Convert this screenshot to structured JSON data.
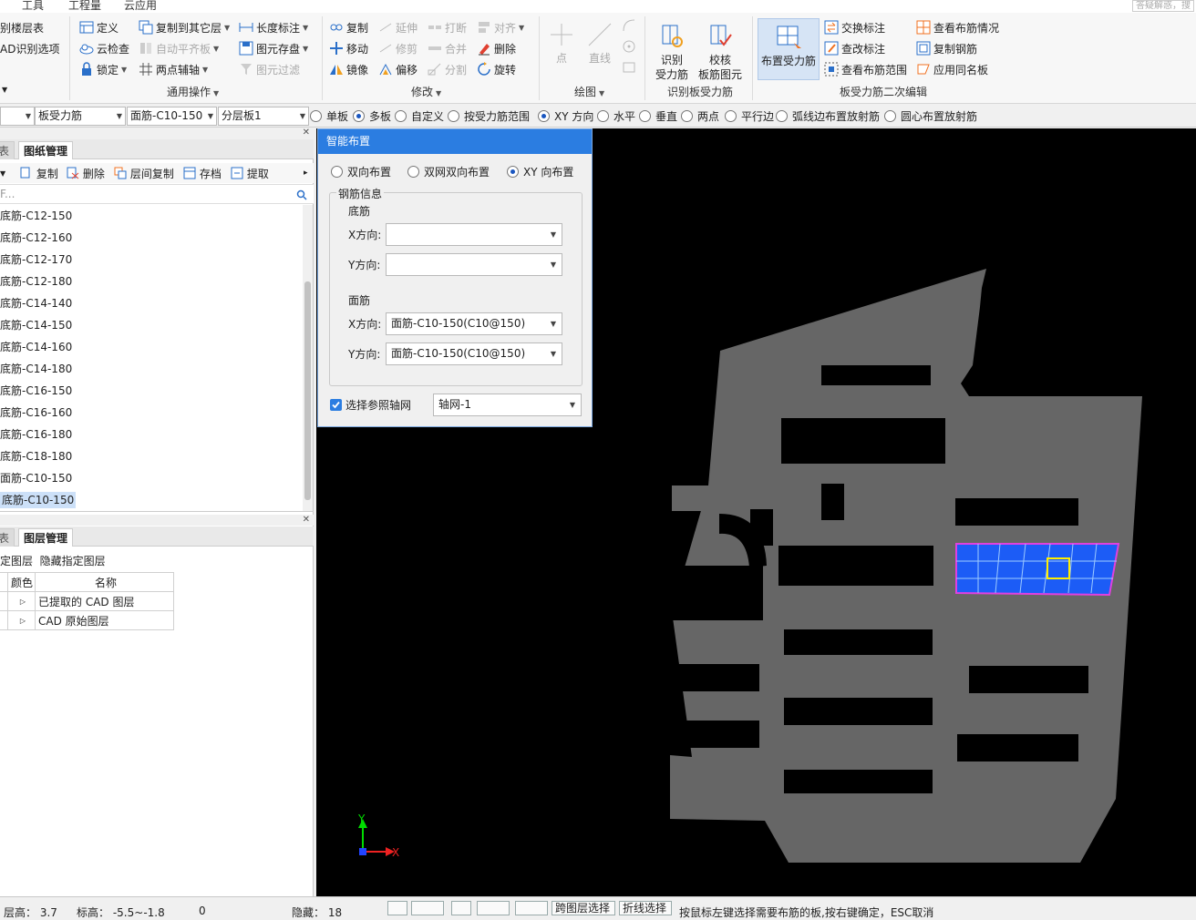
{
  "menu": {
    "items": [
      "工具",
      "工程量",
      "云应用"
    ],
    "search_hint": "答疑解惑，搜"
  },
  "ribbon": {
    "group1": {
      "items": [
        "别楼层表",
        "AD识别选项"
      ]
    },
    "group2": {
      "label": "通用操作",
      "items": [
        "定义",
        "云检查",
        "锁定",
        "复制到其它层",
        "自动平齐板",
        "两点辅轴",
        "长度标注",
        "图元存盘",
        "图元过滤"
      ]
    },
    "group3": {
      "label": "修改",
      "items": [
        "复制",
        "移动",
        "镜像",
        "延伸",
        "修剪",
        "偏移",
        "打断",
        "合并",
        "分割",
        "对齐",
        "删除",
        "旋转"
      ]
    },
    "group4": {
      "label": "绘图",
      "items": [
        "点",
        "直线"
      ]
    },
    "group5": {
      "label": "识别板受力筋",
      "items": [
        "识别\n受力筋",
        "校核\n板筋图元"
      ]
    },
    "group6": {
      "label": "板受力筋二次编辑",
      "big_item": "布置受力筋",
      "items": [
        "交换标注",
        "查改标注",
        "查看布筋范围",
        "查看布筋情况",
        "复制钢筋",
        "应用同名板"
      ]
    }
  },
  "toolbar2": {
    "combo0": "",
    "combo1": "板受力筋",
    "combo2": "面筋-C10-150",
    "combo3": "分层板1",
    "radios_left": [
      "单板",
      "多板",
      "自定义",
      "按受力筋范围"
    ],
    "radios_left_selected": "多板",
    "radios_right": [
      "XY 方向",
      "水平",
      "垂直",
      "两点",
      "平行边",
      "弧线边布置放射筋",
      "圆心布置放射筋"
    ],
    "radios_right_selected": "XY 方向"
  },
  "left_panel": {
    "tabs": [
      "表",
      "图纸管理"
    ],
    "toolbar": [
      "复制",
      "删除",
      "层间复制",
      "存档",
      "提取"
    ],
    "search_placeholder": "F...",
    "list_items": [
      "底筋-C12-150",
      "底筋-C12-160",
      "底筋-C12-170",
      "底筋-C12-180",
      "底筋-C14-140",
      "底筋-C14-150",
      "底筋-C14-160",
      "底筋-C14-180",
      "底筋-C16-150",
      "底筋-C16-160",
      "底筋-C16-180",
      "底筋-C18-180",
      "面筋-C10-150",
      "底筋-C10-150"
    ],
    "selected_index": 13,
    "bottom_tabs": [
      "表",
      "图层管理"
    ],
    "bottom_links": [
      "定图层",
      "隐藏指定图层"
    ],
    "table_headers": [
      "颜色",
      "名称"
    ],
    "table_rows": [
      "已提取的 CAD 图层",
      "CAD 原始图层"
    ]
  },
  "dialog": {
    "title": "智能布置",
    "modes": [
      "双向布置",
      "双网双向布置",
      "XY 向布置"
    ],
    "mode_selected": "XY 向布置",
    "group_title": "钢筋信息",
    "bottom_label": "底筋",
    "top_label": "面筋",
    "x_label": "X方向:",
    "y_label": "Y方向:",
    "bottom_x": "",
    "bottom_y": "",
    "top_x": "面筋-C10-150(C10@150)",
    "top_y": "面筋-C10-150(C10@150)",
    "ref_axis_checkbox": "选择参照轴网",
    "ref_axis_checked": true,
    "ref_axis_value": "轴网-1"
  },
  "canvas": {
    "axis_x": "X",
    "axis_y": "Y"
  },
  "statusbar": {
    "floor_height_label": "层高：",
    "floor_height": "3.7",
    "elev_label": "标高：",
    "elev": "-5.5~-1.8",
    "zero": "0",
    "hidden_label": "隐藏：",
    "hidden": "18",
    "btn_cross_layer": "跨图层选择",
    "btn_polyline": "折线选择",
    "hint": "按鼠标左键选择需要布筋的板,按右键确定，ESC取消"
  }
}
